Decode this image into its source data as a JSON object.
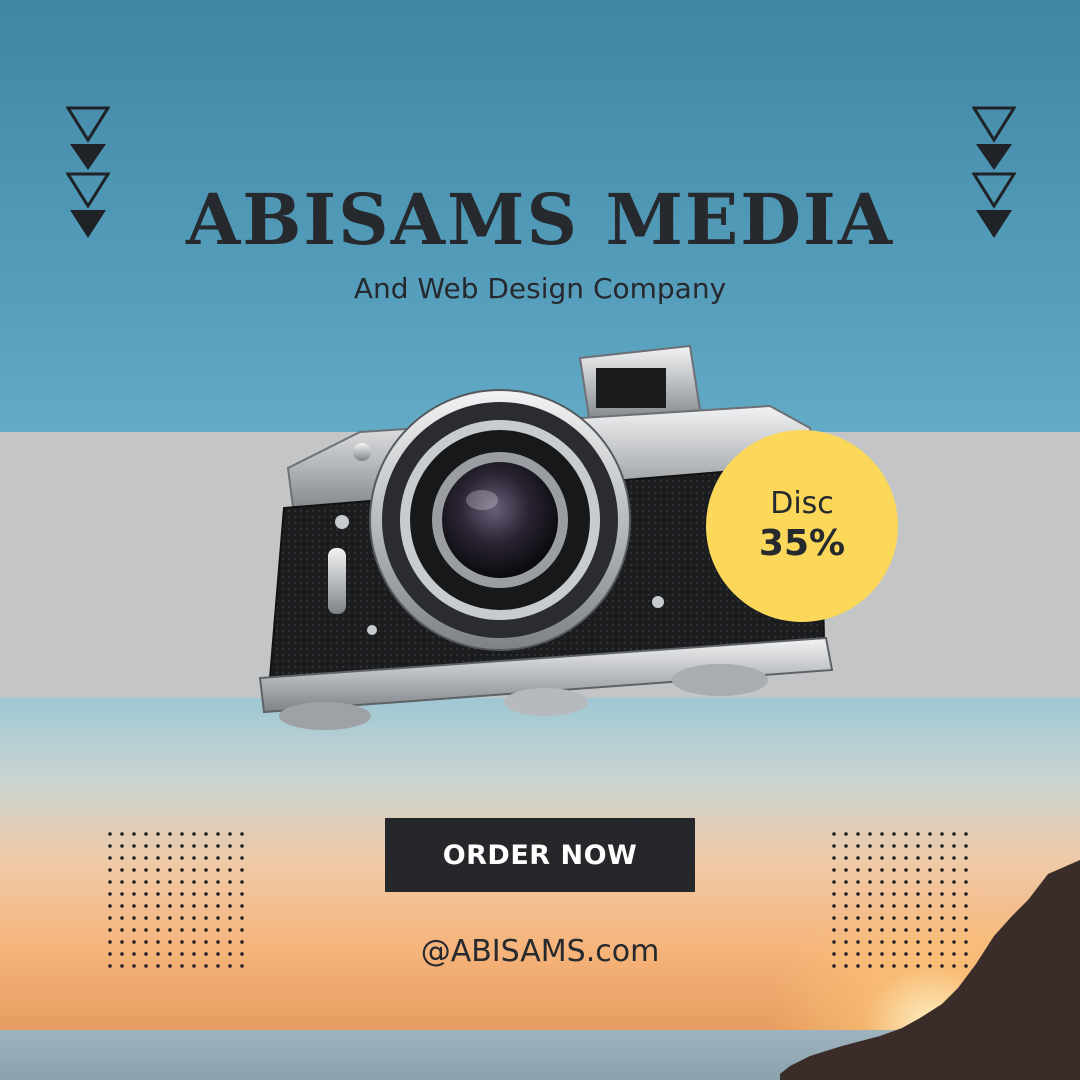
{
  "header": {
    "title": "ABISAMS MEDIA",
    "subtitle": "And Web Design Company"
  },
  "badge": {
    "label": "Disc",
    "value": "35%"
  },
  "cta": {
    "order_label": "ORDER NOW"
  },
  "footer": {
    "handle": "@ABISAMS.com"
  },
  "colors": {
    "title": "#26292d",
    "badge": "#fbd85a",
    "button": "#25272b",
    "band": "#c4c5c7"
  },
  "icons": {
    "decor_left": "triangles-icon",
    "decor_right": "triangles-icon",
    "hero": "camera-icon"
  }
}
